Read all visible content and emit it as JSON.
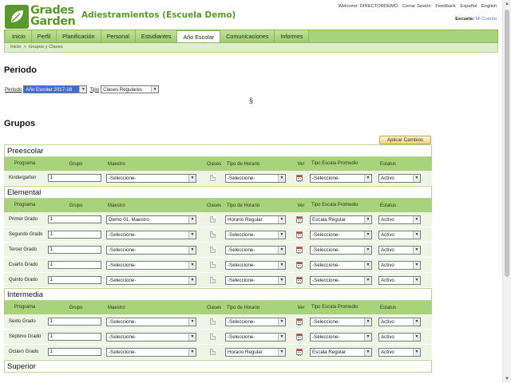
{
  "header": {
    "logo_line1": "Grades",
    "logo_line2": "Garden",
    "app_title": "Adiestramientos (Escuela Demo)",
    "welcome": "Welcome: DIRECTORDEMO",
    "links": [
      "Cerrar Sesión",
      "Feedback",
      "Español",
      "English"
    ],
    "school_label": "Escuela",
    "separator": "|",
    "account_label": "Mi Cuenta"
  },
  "nav": {
    "tabs": [
      "Inicio",
      "Perfil",
      "Planificación",
      "Personal",
      "Estudiantes",
      "Año Escolar",
      "Comunicaciones",
      "Informes"
    ],
    "active_index": 5
  },
  "breadcrumb": {
    "items": [
      "Inicio",
      "Grupos y Clases"
    ],
    "separator": ">"
  },
  "periodo": {
    "title": "Periodo",
    "periodo_label": "Periodo",
    "periodo_value": "Año Escolar 2017-18",
    "tipo_label": "Tipo",
    "tipo_value": "Clases Regulares",
    "section_mark": "§"
  },
  "grupos": {
    "title": "Grupos",
    "apply_button": "Aplicar Cambios",
    "columns": {
      "programa": "Programa",
      "grupo": "Grupo",
      "maestro": "Maestro",
      "clases": "Clases",
      "tipo_horario": "Tipo de Horario",
      "ver": "Ver",
      "tipo_escala": "Tipo Escala Promedio",
      "estatus": "Estatus"
    },
    "sections": [
      {
        "name": "Preescolar",
        "rows": [
          {
            "programa": "Kindergarten",
            "grupo": "1",
            "maestro": "-Seleccione-",
            "tipo_horario": "-Seleccione-",
            "tipo_escala": "-Seleccione-",
            "estatus": "Activo"
          }
        ]
      },
      {
        "name": "Elemental",
        "rows": [
          {
            "programa": "Primer Grado",
            "grupo": "1",
            "maestro": "Demo 01, Maestro",
            "tipo_horario": "Horario Regular",
            "tipo_escala": "Escala Regular",
            "estatus": "Activo"
          },
          {
            "programa": "Segundo Grado",
            "grupo": "1",
            "maestro": "-Seleccione-",
            "tipo_horario": "-Seleccione-",
            "tipo_escala": "-Seleccione-",
            "estatus": "Activo"
          },
          {
            "programa": "Tercer Grado",
            "grupo": "1",
            "maestro": "-Seleccione-",
            "tipo_horario": "-Seleccione-",
            "tipo_escala": "-Seleccione-",
            "estatus": "Activo"
          },
          {
            "programa": "Cuarto Grado",
            "grupo": "1",
            "maestro": "-Seleccione-",
            "tipo_horario": "-Seleccione-",
            "tipo_escala": "-Seleccione-",
            "estatus": "Activo"
          },
          {
            "programa": "Quinto Grado",
            "grupo": "1",
            "maestro": "-Seleccione-",
            "tipo_horario": "-Seleccione-",
            "tipo_escala": "-Seleccione-",
            "estatus": "Activo"
          }
        ]
      },
      {
        "name": "Intermedia",
        "rows": [
          {
            "programa": "Sexto Grado",
            "grupo": "1",
            "maestro": "-Seleccione-",
            "tipo_horario": "-Seleccione-",
            "tipo_escala": "-Seleccione-",
            "estatus": "Activo"
          },
          {
            "programa": "Séptimo Grado",
            "grupo": "1",
            "maestro": "-Seleccione-",
            "tipo_horario": "-Seleccione-",
            "tipo_escala": "-Seleccione-",
            "estatus": "Activo"
          },
          {
            "programa": "Octavo Grado",
            "grupo": "1",
            "maestro": "-Seleccione-",
            "tipo_horario": "Horario Regular",
            "tipo_escala": "Escala Regular",
            "estatus": "Activo"
          }
        ]
      },
      {
        "name": "Superior",
        "rows": []
      }
    ]
  },
  "icons": {
    "logo": "leaf-logo-icon",
    "clases": "document-icon",
    "ver": "calendar-icon",
    "dropdown": "chevron-down-icon"
  },
  "colors": {
    "brand_green": "#5a9a2c",
    "nav_green": "#a9d27c",
    "row_bg": "#eef5e4",
    "button_bg": "#f4d27c",
    "selected_select": "#3c6fd0"
  }
}
